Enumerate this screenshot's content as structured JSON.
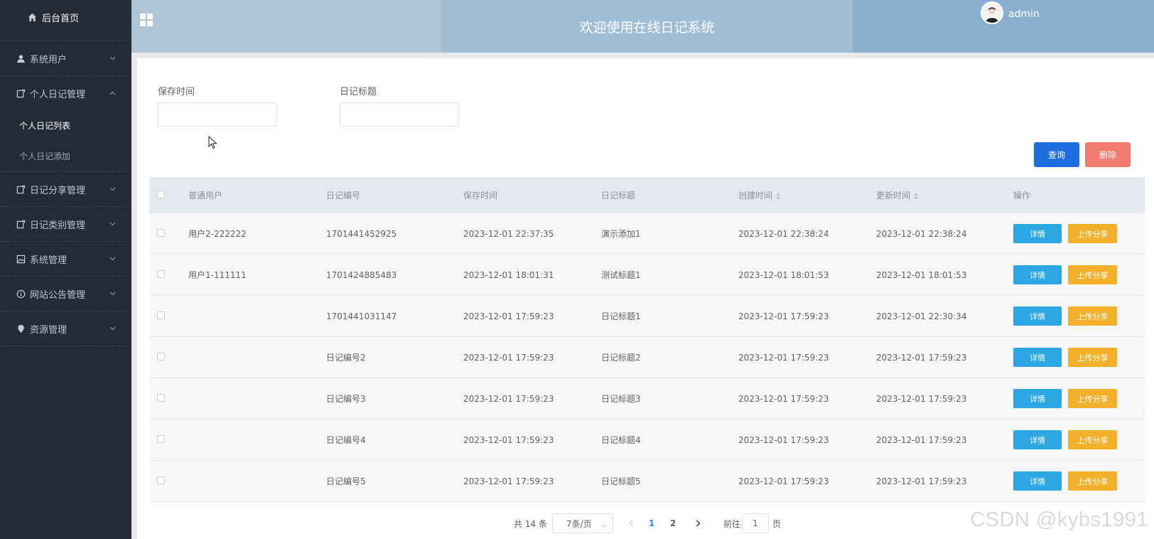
{
  "sidebar": {
    "home_label": "后台首页",
    "groups": [
      {
        "label": "系统用户",
        "icon": "user-icon",
        "expanded": false,
        "items": []
      },
      {
        "label": "个人日记管理",
        "icon": "diary-icon",
        "expanded": true,
        "items": [
          {
            "label": "个人日记列表",
            "active": true
          },
          {
            "label": "个人日记添加",
            "active": false
          }
        ]
      },
      {
        "label": "日记分享管理",
        "icon": "share-icon",
        "expanded": false,
        "items": []
      },
      {
        "label": "日记类别管理",
        "icon": "category-icon",
        "expanded": false,
        "items": []
      },
      {
        "label": "系统管理",
        "icon": "image-icon",
        "expanded": false,
        "items": []
      },
      {
        "label": "网站公告管理",
        "icon": "info-icon",
        "expanded": false,
        "items": []
      },
      {
        "label": "资源管理",
        "icon": "location-icon",
        "expanded": false,
        "items": []
      }
    ]
  },
  "header": {
    "title": "欢迎使用在线日记系统",
    "username": "admin"
  },
  "filters": {
    "save_time_label": "保存时间",
    "save_time_value": "",
    "diary_title_label": "日记标题",
    "diary_title_value": ""
  },
  "toolbar": {
    "query_label": "查询",
    "delete_label": "删除"
  },
  "table": {
    "headers": {
      "user": "普通用户",
      "number": "日记编号",
      "save_time": "保存时间",
      "title": "日记标题",
      "created": "创建时间",
      "updated": "更新时间",
      "actions": "操作"
    },
    "detail_label": "详情",
    "share_label": "上传分享",
    "rows": [
      {
        "user": "用户2-222222",
        "number": "1701441452925",
        "save_time": "2023-12-01 22:37:35",
        "title": "演示添加1",
        "created": "2023-12-01 22:38:24",
        "updated": "2023-12-01 22:38:24"
      },
      {
        "user": "用户1-111111",
        "number": "1701424885483",
        "save_time": "2023-12-01 18:01:31",
        "title": "测试标题1",
        "created": "2023-12-01 18:01:53",
        "updated": "2023-12-01 18:01:53"
      },
      {
        "user": "",
        "number": "1701441031147",
        "save_time": "2023-12-01 17:59:23",
        "title": "日记标题1",
        "created": "2023-12-01 17:59:23",
        "updated": "2023-12-01 22:30:34"
      },
      {
        "user": "",
        "number": "日记编号2",
        "save_time": "2023-12-01 17:59:23",
        "title": "日记标题2",
        "created": "2023-12-01 17:59:23",
        "updated": "2023-12-01 17:59:23"
      },
      {
        "user": "",
        "number": "日记编号3",
        "save_time": "2023-12-01 17:59:23",
        "title": "日记标题3",
        "created": "2023-12-01 17:59:23",
        "updated": "2023-12-01 17:59:23"
      },
      {
        "user": "",
        "number": "日记编号4",
        "save_time": "2023-12-01 17:59:23",
        "title": "日记标题4",
        "created": "2023-12-01 17:59:23",
        "updated": "2023-12-01 17:59:23"
      },
      {
        "user": "",
        "number": "日记编号5",
        "save_time": "2023-12-01 17:59:23",
        "title": "日记标题5",
        "created": "2023-12-01 17:59:23",
        "updated": "2023-12-01 17:59:23"
      }
    ]
  },
  "pagination": {
    "total_text": "共 14 条",
    "page_size": "7条/页",
    "pages": [
      "1",
      "2"
    ],
    "current_page": "1",
    "goto_label": "前往",
    "goto_value": "1",
    "page_unit": "页"
  },
  "watermark": "CSDN @kybs1991",
  "colors": {
    "sidebar_bg": "#242b37",
    "query_button": "#1d6fe0",
    "delete_button": "#f37a6e",
    "detail_button": "#2ca7e3",
    "share_button": "#f3b02b"
  }
}
